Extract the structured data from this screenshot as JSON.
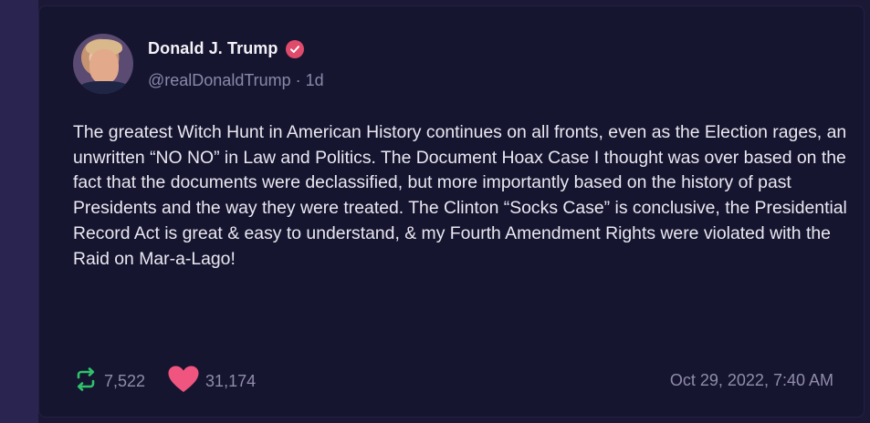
{
  "post": {
    "author": {
      "display_name": "Donald J. Trump",
      "handle": "@realDonaldTrump",
      "age": "1d",
      "verified_icon": "verified-badge-icon"
    },
    "text": "The greatest Witch Hunt in American History continues on all fronts, even as the Election rages, an unwritten “NO NO” in Law and Politics. The Document Hoax Case I thought was over based on the fact that the documents were declassified, but more importantly based on the history of past Presidents and the way they were treated. The Clinton “Socks Case” is conclusive, the Presidential Record Act is great & easy to understand, & my Fourth Amendment Rights were violated with the Raid on Mar-a-Lago!",
    "stats": {
      "reposts": "7,522",
      "likes": "31,174"
    },
    "timestamp": "Oct 29, 2022, 7:40 AM"
  },
  "colors": {
    "background": "#161530",
    "verified": "#e04a6b",
    "repost": "#2fc26b",
    "like": "#f0557f"
  }
}
